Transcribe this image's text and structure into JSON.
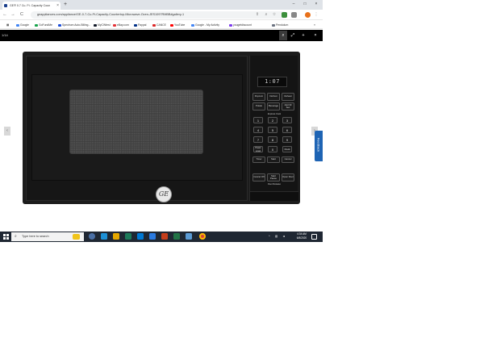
{
  "browser": {
    "tab_title": "GE® 0.7 Cu. Ft. Capacity Coun",
    "tab_close": "×",
    "new_tab": "+",
    "window": {
      "min": "–",
      "max": "□",
      "close": "×"
    },
    "nav": {
      "back": "←",
      "forward": "→",
      "reload": "C"
    },
    "url": "geappliances.com/appliance/GE-0-7-Cu-Ft-Capacity-Countertop-Microwave-Oven-JES1097RMBB#gallery-1",
    "bookmarks": [
      {
        "label": "Google",
        "color": "#4285f4"
      },
      {
        "label": "GoFundMe",
        "color": "#16a34a"
      },
      {
        "label": "Spectrum Auto-Billing...",
        "color": "#1d4ed8"
      },
      {
        "label": "MyCWtest",
        "color": "#111827"
      },
      {
        "label": "eBay.com",
        "color": "#e53238"
      },
      {
        "label": "Paypal",
        "color": "#003087"
      },
      {
        "label": "CANCE",
        "color": "#dc2626"
      },
      {
        "label": "YouTube",
        "color": "#ff0000"
      },
      {
        "label": "Google - My Activity",
        "color": "#4285f4"
      },
      {
        "label": "yougetdiscount",
        "color": "#7c3aed"
      },
      {
        "label": "Pendulum",
        "color": "#6b7280"
      }
    ],
    "bookmarks_more": "»"
  },
  "viewer": {
    "counter": "1/14",
    "tools": {
      "zoom": "🔍",
      "expand": "⤢",
      "share": "+",
      "close": "×"
    },
    "prev": "‹",
    "next": "›",
    "feedback": "Feedback"
  },
  "microwave": {
    "display": "1:07",
    "logo": "GE",
    "top_buttons": [
      [
        "Popcorn",
        "Defrost",
        "Reheat"
      ],
      [
        "Potato",
        "Beverage",
        "Add 30 Sec"
      ]
    ],
    "express_label": "Express Cook",
    "keys": [
      "1",
      "2",
      "3",
      "4",
      "5",
      "6",
      "7",
      "8",
      "9",
      "Power Level",
      "0",
      "Clock"
    ],
    "mid_buttons": [
      "Timer",
      "Start",
      "Cancel"
    ],
    "bottom_buttons": [
      "Cancel Off",
      "Start Pause",
      "Open Door"
    ],
    "door_label": "Door Release"
  },
  "taskbar": {
    "search_placeholder": "Type here to search",
    "time": "4:34 AM",
    "date": "6/8/2020",
    "tray_lang": "ENG"
  }
}
